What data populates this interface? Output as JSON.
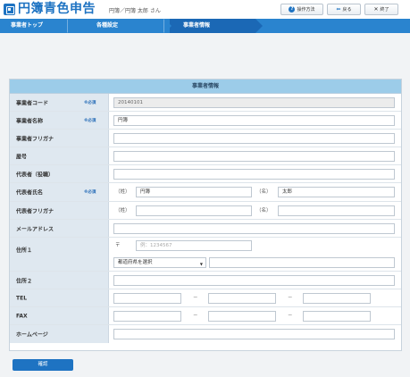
{
  "header": {
    "app_title": "円簿青色申告",
    "user_info": "円簿／円簿 太郎 さん",
    "help_label": "操作方法",
    "help_icon": "?",
    "back_label": "戻る",
    "back_icon": "⇚",
    "close_label": "終了",
    "close_icon": "✕"
  },
  "nav": {
    "items": [
      "事業者トップ",
      "各種設定",
      "事業者情報"
    ]
  },
  "colors": {
    "accent": "#1e73c2",
    "nav": "#2a84cf",
    "panel_title": "#9ccce9",
    "label_bg": "#dfe8f0"
  },
  "form": {
    "title": "事業者情報",
    "required": "※必須",
    "code": {
      "label": "事業者コード",
      "value": "20140101"
    },
    "name": {
      "label": "事業者名称",
      "value": "円簿"
    },
    "kana": {
      "label": "事業者フリガナ",
      "value": ""
    },
    "yago": {
      "label": "屋号",
      "value": ""
    },
    "rep_title": {
      "label": "代表者（役職）",
      "value": ""
    },
    "rep_name": {
      "label": "代表者氏名",
      "sei": "（姓）",
      "mei": "（名）",
      "sei_value": "円簿",
      "mei_value": "太郎"
    },
    "rep_kana": {
      "label": "代表者フリガナ",
      "sei": "（姓）",
      "mei": "（名）"
    },
    "email": {
      "label": "メールアドレス",
      "value": ""
    },
    "addr1": {
      "label": "住所１",
      "postal_mark": "〒",
      "postal_placeholder": "例：1234567",
      "pref_select": "都道府県を選択",
      "pref_arrow": "▼"
    },
    "addr2": {
      "label": "住所２",
      "value": ""
    },
    "tel": {
      "label": "TEL",
      "dash": "－"
    },
    "fax": {
      "label": "FAX",
      "dash": "－"
    },
    "homepage": {
      "label": "ホームページ",
      "value": ""
    },
    "confirm_label": "確認"
  }
}
